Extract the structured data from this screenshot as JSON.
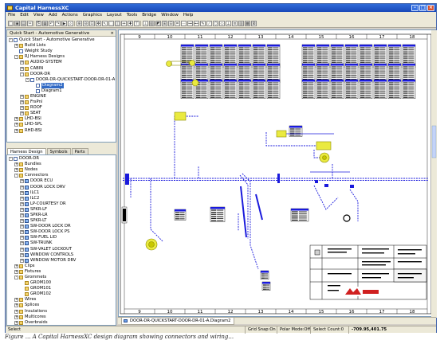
{
  "window": {
    "title": "Capital HarnessXC"
  },
  "menu": [
    "File",
    "Edit",
    "View",
    "Add",
    "Actions",
    "Graphics",
    "Layout",
    "Tools",
    "Bridge",
    "Window",
    "Help"
  ],
  "top_panel": {
    "title": "Quick Start - Automotive Generative",
    "items": [
      {
        "label": "Quick Start - Automotive Generative",
        "level": 0,
        "expander": "-",
        "icon": "doc"
      },
      {
        "label": "Build Lists",
        "level": 1,
        "expander": "+",
        "icon": "folder"
      },
      {
        "label": "Weight Study",
        "level": 1,
        "expander": "",
        "icon": "doc"
      },
      {
        "label": "RJ Harness Designs",
        "level": 1,
        "expander": "-",
        "icon": "folder"
      },
      {
        "label": "AUDIO-SYSTEM",
        "level": 2,
        "expander": "+",
        "icon": "folder"
      },
      {
        "label": "CABIN",
        "level": 2,
        "expander": "+",
        "icon": "folder"
      },
      {
        "label": "DOOR-DR",
        "level": 2,
        "expander": "-",
        "icon": "folder"
      },
      {
        "label": "DOOR-DR-QUICKSTART-DOOR-DR-01-A",
        "level": 3,
        "expander": "-",
        "icon": "doc"
      },
      {
        "label": "Diagram2",
        "level": 4,
        "expander": "",
        "icon": "doc",
        "selected": true
      },
      {
        "label": "Diagram1",
        "level": 4,
        "expander": "",
        "icon": "doc"
      },
      {
        "label": "ENGINE",
        "level": 2,
        "expander": "+",
        "icon": "folder"
      },
      {
        "label": "FrsPnl",
        "level": 2,
        "expander": "+",
        "icon": "folder"
      },
      {
        "label": "ROOF",
        "level": 2,
        "expander": "+",
        "icon": "folder"
      },
      {
        "label": "SEAT",
        "level": 2,
        "expander": "+",
        "icon": "folder"
      },
      {
        "label": "LHD-BSI",
        "level": 1,
        "expander": "+",
        "icon": "folder"
      },
      {
        "label": "LHD-SPL",
        "level": 1,
        "expander": "+",
        "icon": "folder"
      },
      {
        "label": "RHD-BSI",
        "level": 1,
        "expander": "+",
        "icon": "folder"
      }
    ]
  },
  "tabs": [
    "Harness Design",
    "Symbols",
    "Parts"
  ],
  "bottom_panel": {
    "items": [
      {
        "label": "DOOR-DR",
        "level": 0,
        "expander": "-",
        "icon": "doc"
      },
      {
        "label": "Bundles",
        "level": 1,
        "expander": "+",
        "icon": "folder"
      },
      {
        "label": "Nodes",
        "level": 1,
        "expander": "+",
        "icon": "folder"
      },
      {
        "label": "Connectors",
        "level": 1,
        "expander": "-",
        "icon": "folder"
      },
      {
        "label": "DOOR ECU",
        "level": 2,
        "expander": "+",
        "icon": "conn"
      },
      {
        "label": "DOOR LOCK DRV",
        "level": 2,
        "expander": "+",
        "icon": "conn"
      },
      {
        "label": "ILC1",
        "level": 2,
        "expander": "+",
        "icon": "conn"
      },
      {
        "label": "ILC2",
        "level": 2,
        "expander": "+",
        "icon": "conn"
      },
      {
        "label": "LP-COURTESY DR",
        "level": 2,
        "expander": "+",
        "icon": "conn"
      },
      {
        "label": "SPKR-LF",
        "level": 2,
        "expander": "+",
        "icon": "conn"
      },
      {
        "label": "SPKR-LR",
        "level": 2,
        "expander": "+",
        "icon": "conn"
      },
      {
        "label": "SPKR-LT",
        "level": 2,
        "expander": "+",
        "icon": "conn"
      },
      {
        "label": "SW-DOOR LOCK DR",
        "level": 2,
        "expander": "+",
        "icon": "conn"
      },
      {
        "label": "SW-DOOR LOCK PS",
        "level": 2,
        "expander": "+",
        "icon": "conn"
      },
      {
        "label": "SW-FUEL LID",
        "level": 2,
        "expander": "+",
        "icon": "conn"
      },
      {
        "label": "SW-TRUNK",
        "level": 2,
        "expander": "+",
        "icon": "conn"
      },
      {
        "label": "SW-VALET LOCKOUT",
        "level": 2,
        "expander": "+",
        "icon": "conn"
      },
      {
        "label": "WINDOW CONTROLS",
        "level": 2,
        "expander": "+",
        "icon": "conn"
      },
      {
        "label": "WINDOW MOTOR DRV",
        "level": 2,
        "expander": "+",
        "icon": "conn"
      },
      {
        "label": "Clips",
        "level": 1,
        "expander": "+",
        "icon": "folder"
      },
      {
        "label": "Fixtures",
        "level": 1,
        "expander": "+",
        "icon": "folder"
      },
      {
        "label": "Grommets",
        "level": 1,
        "expander": "-",
        "icon": "folder"
      },
      {
        "label": "GROM100",
        "level": 2,
        "expander": "",
        "icon": "folder"
      },
      {
        "label": "GROM101",
        "level": 2,
        "expander": "",
        "icon": "folder"
      },
      {
        "label": "GROM102",
        "level": 2,
        "expander": "",
        "icon": "folder"
      },
      {
        "label": "Wires",
        "level": 1,
        "expander": "+",
        "icon": "folder"
      },
      {
        "label": "Splices",
        "level": 1,
        "expander": "+",
        "icon": "folder"
      },
      {
        "label": "Insulations",
        "level": 1,
        "expander": "+",
        "icon": "folder"
      },
      {
        "label": "Multicores",
        "level": 1,
        "expander": "+",
        "icon": "folder"
      },
      {
        "label": "Overbraids",
        "level": 1,
        "expander": "+",
        "icon": "folder"
      },
      {
        "label": "Multi-Location",
        "level": 1,
        "expander": "+",
        "icon": "folder"
      },
      {
        "label": "Other Components",
        "level": 1,
        "expander": "+",
        "icon": "folder"
      }
    ]
  },
  "canvas": {
    "top_ruler": [
      "9",
      "10",
      "11",
      "12",
      "13",
      "14",
      "15",
      "16",
      "17",
      "18"
    ],
    "bottom_ruler": [
      "9",
      "10",
      "11",
      "12",
      "13",
      "14",
      "15",
      "16",
      "17",
      "18"
    ],
    "wire_color": "#1a1adc",
    "accent_yellow": "#c8c800",
    "title_block_logo": "mentor"
  },
  "document_tab": {
    "label": "DOOR-DR-QUICKSTART-DOOR-DR-01-A.Diagram2"
  },
  "status": {
    "left": "Select",
    "grid_snap": "Grid Snap:On",
    "polar_mode": "Polar Mode:Off",
    "select_count": "Select Count:0",
    "coordinates": "-709.95,401.75"
  },
  "caption": "Figure ... A Capital HarnessXC design diagram showing connectors and wiring..."
}
